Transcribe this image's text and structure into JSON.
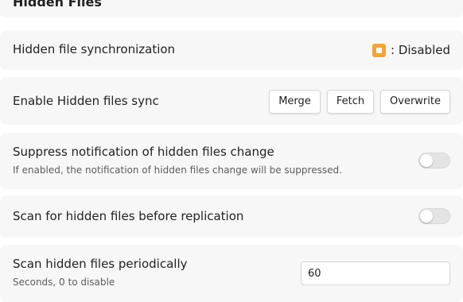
{
  "section": {
    "title": "Hidden Files"
  },
  "rows": {
    "sync_status": {
      "label": "Hidden file synchronization",
      "status_text": ": Disabled",
      "status_icon": "orange-stop-square-icon",
      "status_color": "#f0a43a"
    },
    "enable_sync": {
      "label": "Enable Hidden files sync",
      "buttons": {
        "merge": "Merge",
        "fetch": "Fetch",
        "overwrite": "Overwrite"
      }
    },
    "suppress_notification": {
      "label": "Suppress notification of hidden files change",
      "description": "If enabled, the notification of hidden files change will be suppressed.",
      "enabled": false
    },
    "scan_before_replication": {
      "label": "Scan for hidden files before replication",
      "enabled": false
    },
    "scan_periodically": {
      "label": "Scan hidden files periodically",
      "description": "Seconds, 0 to disable",
      "value": "60"
    }
  }
}
